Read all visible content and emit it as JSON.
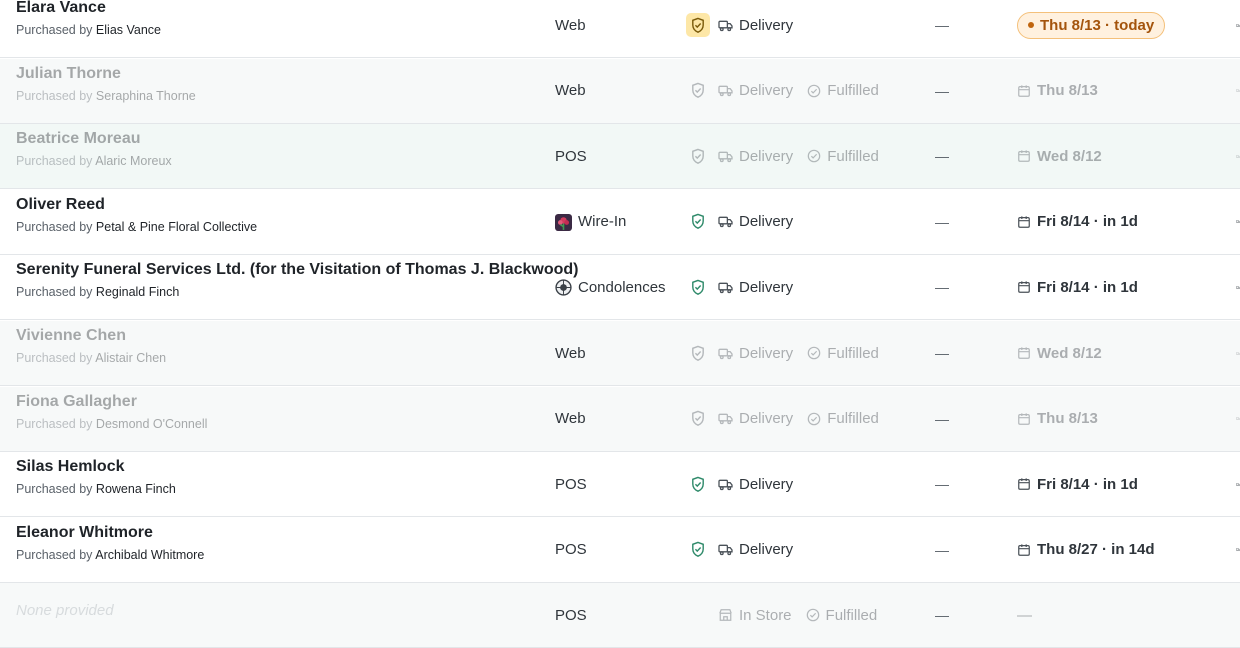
{
  "labels": {
    "purchased_by": "Purchased by",
    "dash": "—"
  },
  "colors": {
    "accent_green": "#2f8a6a",
    "alert_yellow": "#fde7a7",
    "today_orange": "#c0650e",
    "muted_gray": "#a4abb1"
  },
  "rows": [
    {
      "name": "Elara Vance",
      "buyer": "Elias Vance",
      "source": "Web",
      "source_icon": "",
      "shield": "alert",
      "tags": [
        {
          "icon": "truck-icon",
          "label": "Delivery"
        }
      ],
      "date": "Thu 8/13 · today",
      "date_style": "today",
      "dim": false,
      "bg": ""
    },
    {
      "name": "Julian Thorne",
      "buyer": "Seraphina Thorne",
      "source": "Web",
      "source_icon": "",
      "shield": "plain",
      "tags": [
        {
          "icon": "truck-icon",
          "label": "Delivery"
        },
        {
          "icon": "check-circle-icon",
          "label": "Fulfilled"
        }
      ],
      "date": "Thu 8/13",
      "date_style": "cal",
      "dim": true,
      "bg": "alt"
    },
    {
      "name": "Beatrice Moreau",
      "buyer": "Alaric Moreux",
      "source": "POS",
      "source_icon": "",
      "shield": "plain",
      "tags": [
        {
          "icon": "truck-icon",
          "label": "Delivery"
        },
        {
          "icon": "check-circle-icon",
          "label": "Fulfilled"
        }
      ],
      "date": "Wed 8/12",
      "date_style": "cal",
      "dim": true,
      "bg": "hl"
    },
    {
      "name": "Oliver Reed",
      "buyer": "Petal & Pine Floral Collective",
      "source": "Wire-In",
      "source_icon": "flower-icon",
      "shield": "green",
      "tags": [
        {
          "icon": "truck-icon",
          "label": "Delivery"
        }
      ],
      "date": "Fri 8/14 · in 1d",
      "date_style": "cal",
      "dim": false,
      "bg": ""
    },
    {
      "name": "Serenity Funeral Services Ltd. (for the Visitation of Thomas J. Blackwood)",
      "buyer": "Reginald Finch",
      "source": "Condolences",
      "source_icon": "globe-icon",
      "shield": "green",
      "tags": [
        {
          "icon": "truck-icon",
          "label": "Delivery"
        }
      ],
      "date": "Fri 8/14 · in 1d",
      "date_style": "cal",
      "dim": false,
      "bg": ""
    },
    {
      "name": "Vivienne Chen",
      "buyer": "Alistair Chen",
      "source": "Web",
      "source_icon": "",
      "shield": "plain",
      "tags": [
        {
          "icon": "truck-icon",
          "label": "Delivery"
        },
        {
          "icon": "check-circle-icon",
          "label": "Fulfilled"
        }
      ],
      "date": "Wed 8/12",
      "date_style": "cal",
      "dim": true,
      "bg": "alt"
    },
    {
      "name": "Fiona Gallagher",
      "buyer": "Desmond O'Connell",
      "source": "Web",
      "source_icon": "",
      "shield": "plain",
      "tags": [
        {
          "icon": "truck-icon",
          "label": "Delivery"
        },
        {
          "icon": "check-circle-icon",
          "label": "Fulfilled"
        }
      ],
      "date": "Thu 8/13",
      "date_style": "cal",
      "dim": true,
      "bg": "alt"
    },
    {
      "name": "Silas Hemlock",
      "buyer": "Rowena Finch",
      "source": "POS",
      "source_icon": "",
      "shield": "green",
      "tags": [
        {
          "icon": "truck-icon",
          "label": "Delivery"
        }
      ],
      "date": "Fri 8/14 · in 1d",
      "date_style": "cal",
      "dim": false,
      "bg": ""
    },
    {
      "name": "Eleanor Whitmore",
      "buyer": "Archibald Whitmore",
      "source": "POS",
      "source_icon": "",
      "shield": "green",
      "tags": [
        {
          "icon": "truck-icon",
          "label": "Delivery"
        }
      ],
      "date": "Thu 8/27 · in 14d",
      "date_style": "cal",
      "dim": false,
      "bg": ""
    },
    {
      "name": "None provided",
      "buyer": "",
      "source": "POS",
      "source_icon": "",
      "shield": "none",
      "tags": [
        {
          "icon": "store-icon",
          "label": "In Store"
        },
        {
          "icon": "check-circle-icon",
          "label": "Fulfilled"
        }
      ],
      "date": "—",
      "date_style": "plain",
      "dim": true,
      "bg": "alt",
      "name_placeholder": true
    }
  ]
}
